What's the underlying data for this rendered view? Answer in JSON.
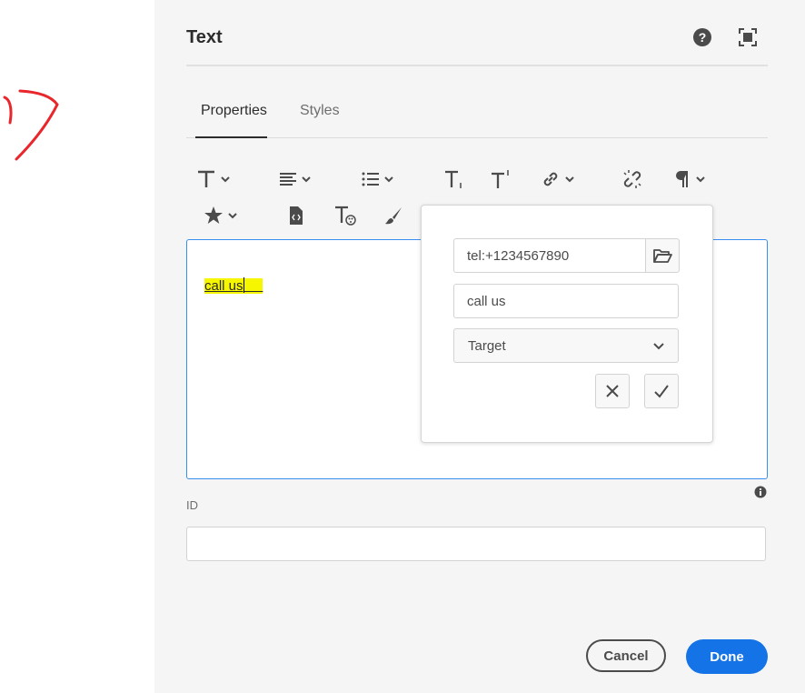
{
  "dialog": {
    "title": "Text",
    "help_icon": "help-icon",
    "fullscreen_icon": "fullscreen-icon"
  },
  "tabs": [
    {
      "label": "Properties",
      "active": true
    },
    {
      "label": "Styles",
      "active": false
    }
  ],
  "toolbar": {
    "row1": [
      "text-format-icon",
      "justify-icon",
      "list-icon",
      "subscript-icon",
      "superscript-icon",
      "link-icon",
      "unlink-icon",
      "paragraph-format-icon"
    ],
    "row2": [
      "special-characters-icon",
      "source-edit-icon",
      "text-style-icon",
      "brush-icon"
    ]
  },
  "editor": {
    "content": "call us"
  },
  "link_popover": {
    "url_value": "tel:+1234567890",
    "text_value": "call us",
    "target_label": "Target"
  },
  "id_field": {
    "label": "ID",
    "value": ""
  },
  "footer": {
    "cancel_label": "Cancel",
    "done_label": "Done"
  },
  "colors": {
    "accent": "#1473e6",
    "highlight": "#f6f600",
    "annotation": "#e8262b",
    "editor_border": "#378ef0"
  }
}
